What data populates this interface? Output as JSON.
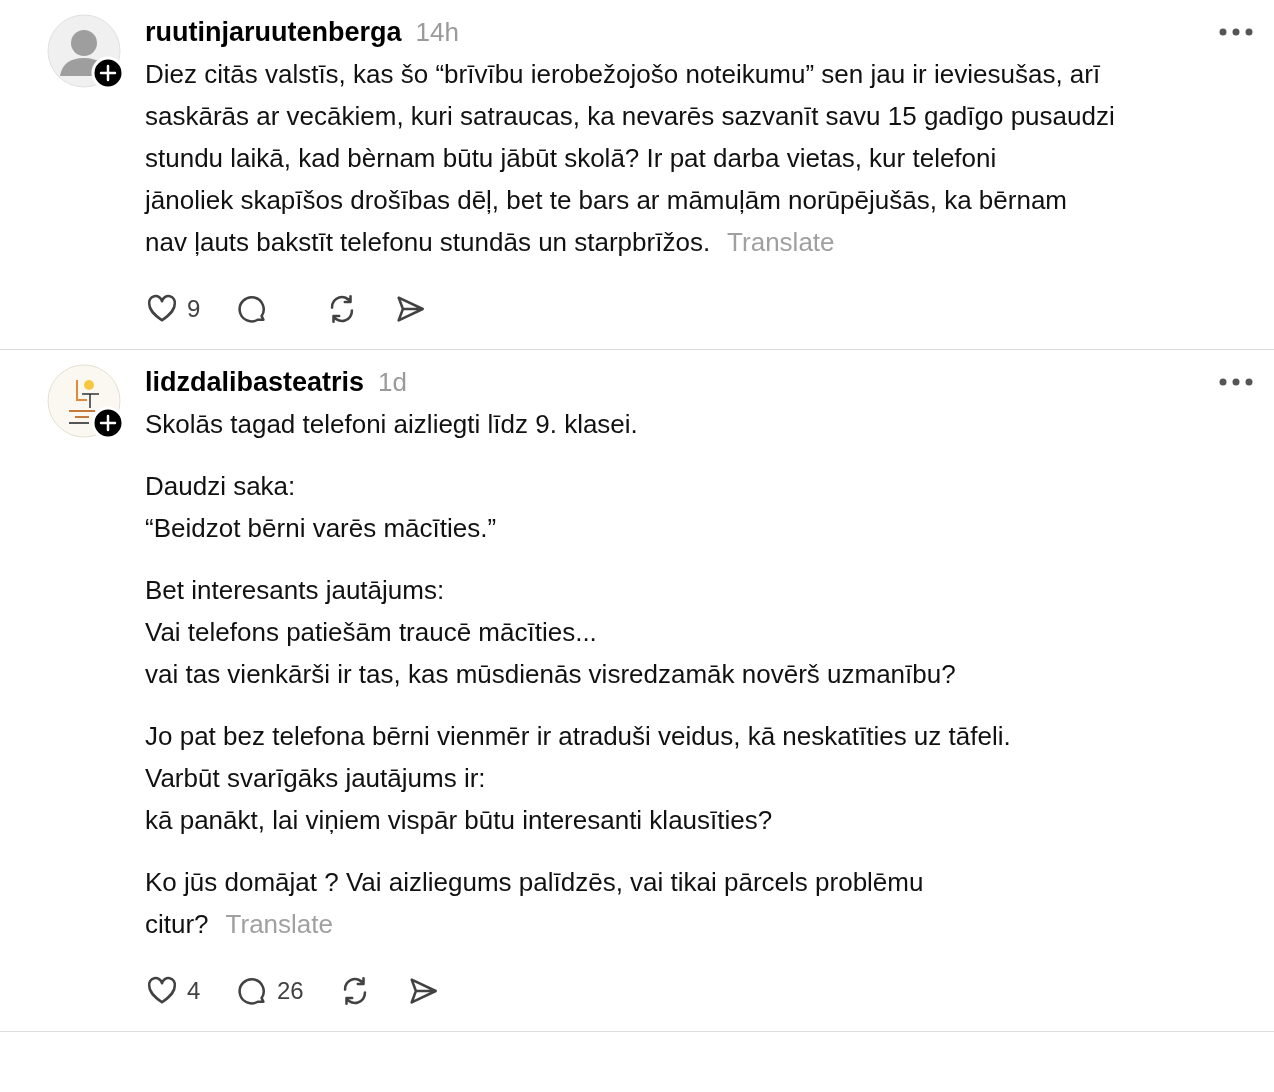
{
  "posts": [
    {
      "username": "ruutinjaruutenberga",
      "time": "14h",
      "avatar": {
        "kind": "person"
      },
      "paragraphs": [
        [
          "Diez citās valstīs, kas šo “brīvību ierobežojošo noteikumu” sen jau ir ieviesušas, arī",
          "saskārās ar vecākiem, kuri satraucas, ka nevarēs sazvanīt savu 15 gadīgo pusaudzi",
          "stundu laikā, kad bèrnam būtu jābūt skolā? Ir pat darba vietas, kur telefoni",
          "jānoliek skapīšos drošības dēļ, bet te bars ar māmuļām norūpējušās, ka bērnam",
          "nav ļauts bakstīt telefonu stundās un starpbrīžos."
        ]
      ],
      "translate": "Translate",
      "likes": "9"
    },
    {
      "username": "lidzdalibasteatris",
      "time": "1d",
      "avatar": {
        "kind": "logo"
      },
      "paragraphs": [
        [
          "Skolās tagad telefoni aizliegti līdz 9. klasei."
        ],
        [
          "Daudzi saka:",
          "“Beidzot bērni varēs mācīties.”"
        ],
        [
          "Bet interesants jautājums:",
          "Vai telefons patiešām traucē mācīties...",
          "vai tas vienkārši ir tas, kas mūsdienās visredzamāk novērš uzmanību?"
        ],
        [
          "Jo pat bez telefona bērni vienmēr ir atraduši veidus, kā neskatīties uz tāfeli.",
          "Varbūt svarīgāks jautājums ir:",
          "kā panākt, lai viņiem vispār būtu interesanti klausīties?"
        ],
        [
          "Ko jūs domājat ? Vai aizliegums palīdzēs, vai tikai pārcels problēmu",
          "citur?"
        ]
      ],
      "translate": "Translate",
      "likes": "4",
      "comments": "26"
    }
  ]
}
